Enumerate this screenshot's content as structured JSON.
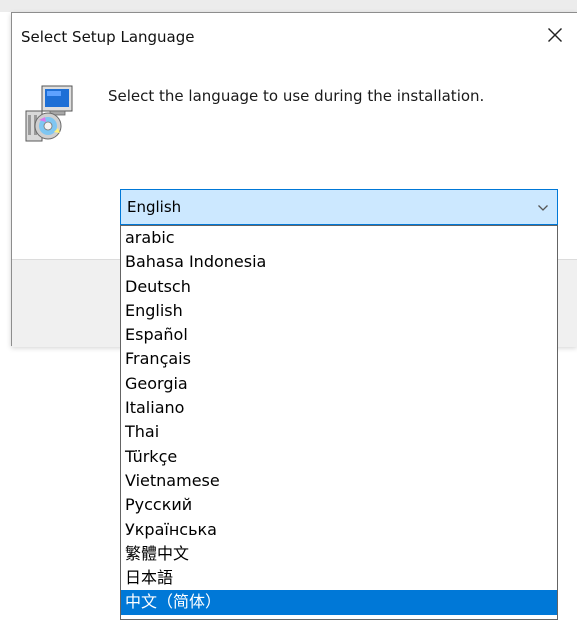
{
  "dialog": {
    "title": "Select Setup Language",
    "prompt": "Select the language to use during the installation.",
    "close_icon": "close-icon",
    "installer_icon": "setup-installer-icon"
  },
  "language_select": {
    "selected_value": "English",
    "arrow_icon": "chevron-down-icon",
    "options": [
      {
        "label": "arabic",
        "highlighted": false
      },
      {
        "label": "Bahasa Indonesia",
        "highlighted": false
      },
      {
        "label": "Deutsch",
        "highlighted": false
      },
      {
        "label": "English",
        "highlighted": false
      },
      {
        "label": "Español",
        "highlighted": false
      },
      {
        "label": "Français",
        "highlighted": false
      },
      {
        "label": "Georgia",
        "highlighted": false
      },
      {
        "label": "Italiano",
        "highlighted": false
      },
      {
        "label": "Thai",
        "highlighted": false
      },
      {
        "label": "Türkçe",
        "highlighted": false
      },
      {
        "label": "Vietnamese",
        "highlighted": false
      },
      {
        "label": "Русский",
        "highlighted": false
      },
      {
        "label": "Українська",
        "highlighted": false
      },
      {
        "label": "繁體中文",
        "highlighted": false
      },
      {
        "label": "日本語",
        "highlighted": false
      },
      {
        "label": "中文（简体）",
        "highlighted": true
      }
    ]
  },
  "colors": {
    "accent": "#0078d7",
    "select_fill": "#cce8ff",
    "footer": "#f0f0f0"
  }
}
